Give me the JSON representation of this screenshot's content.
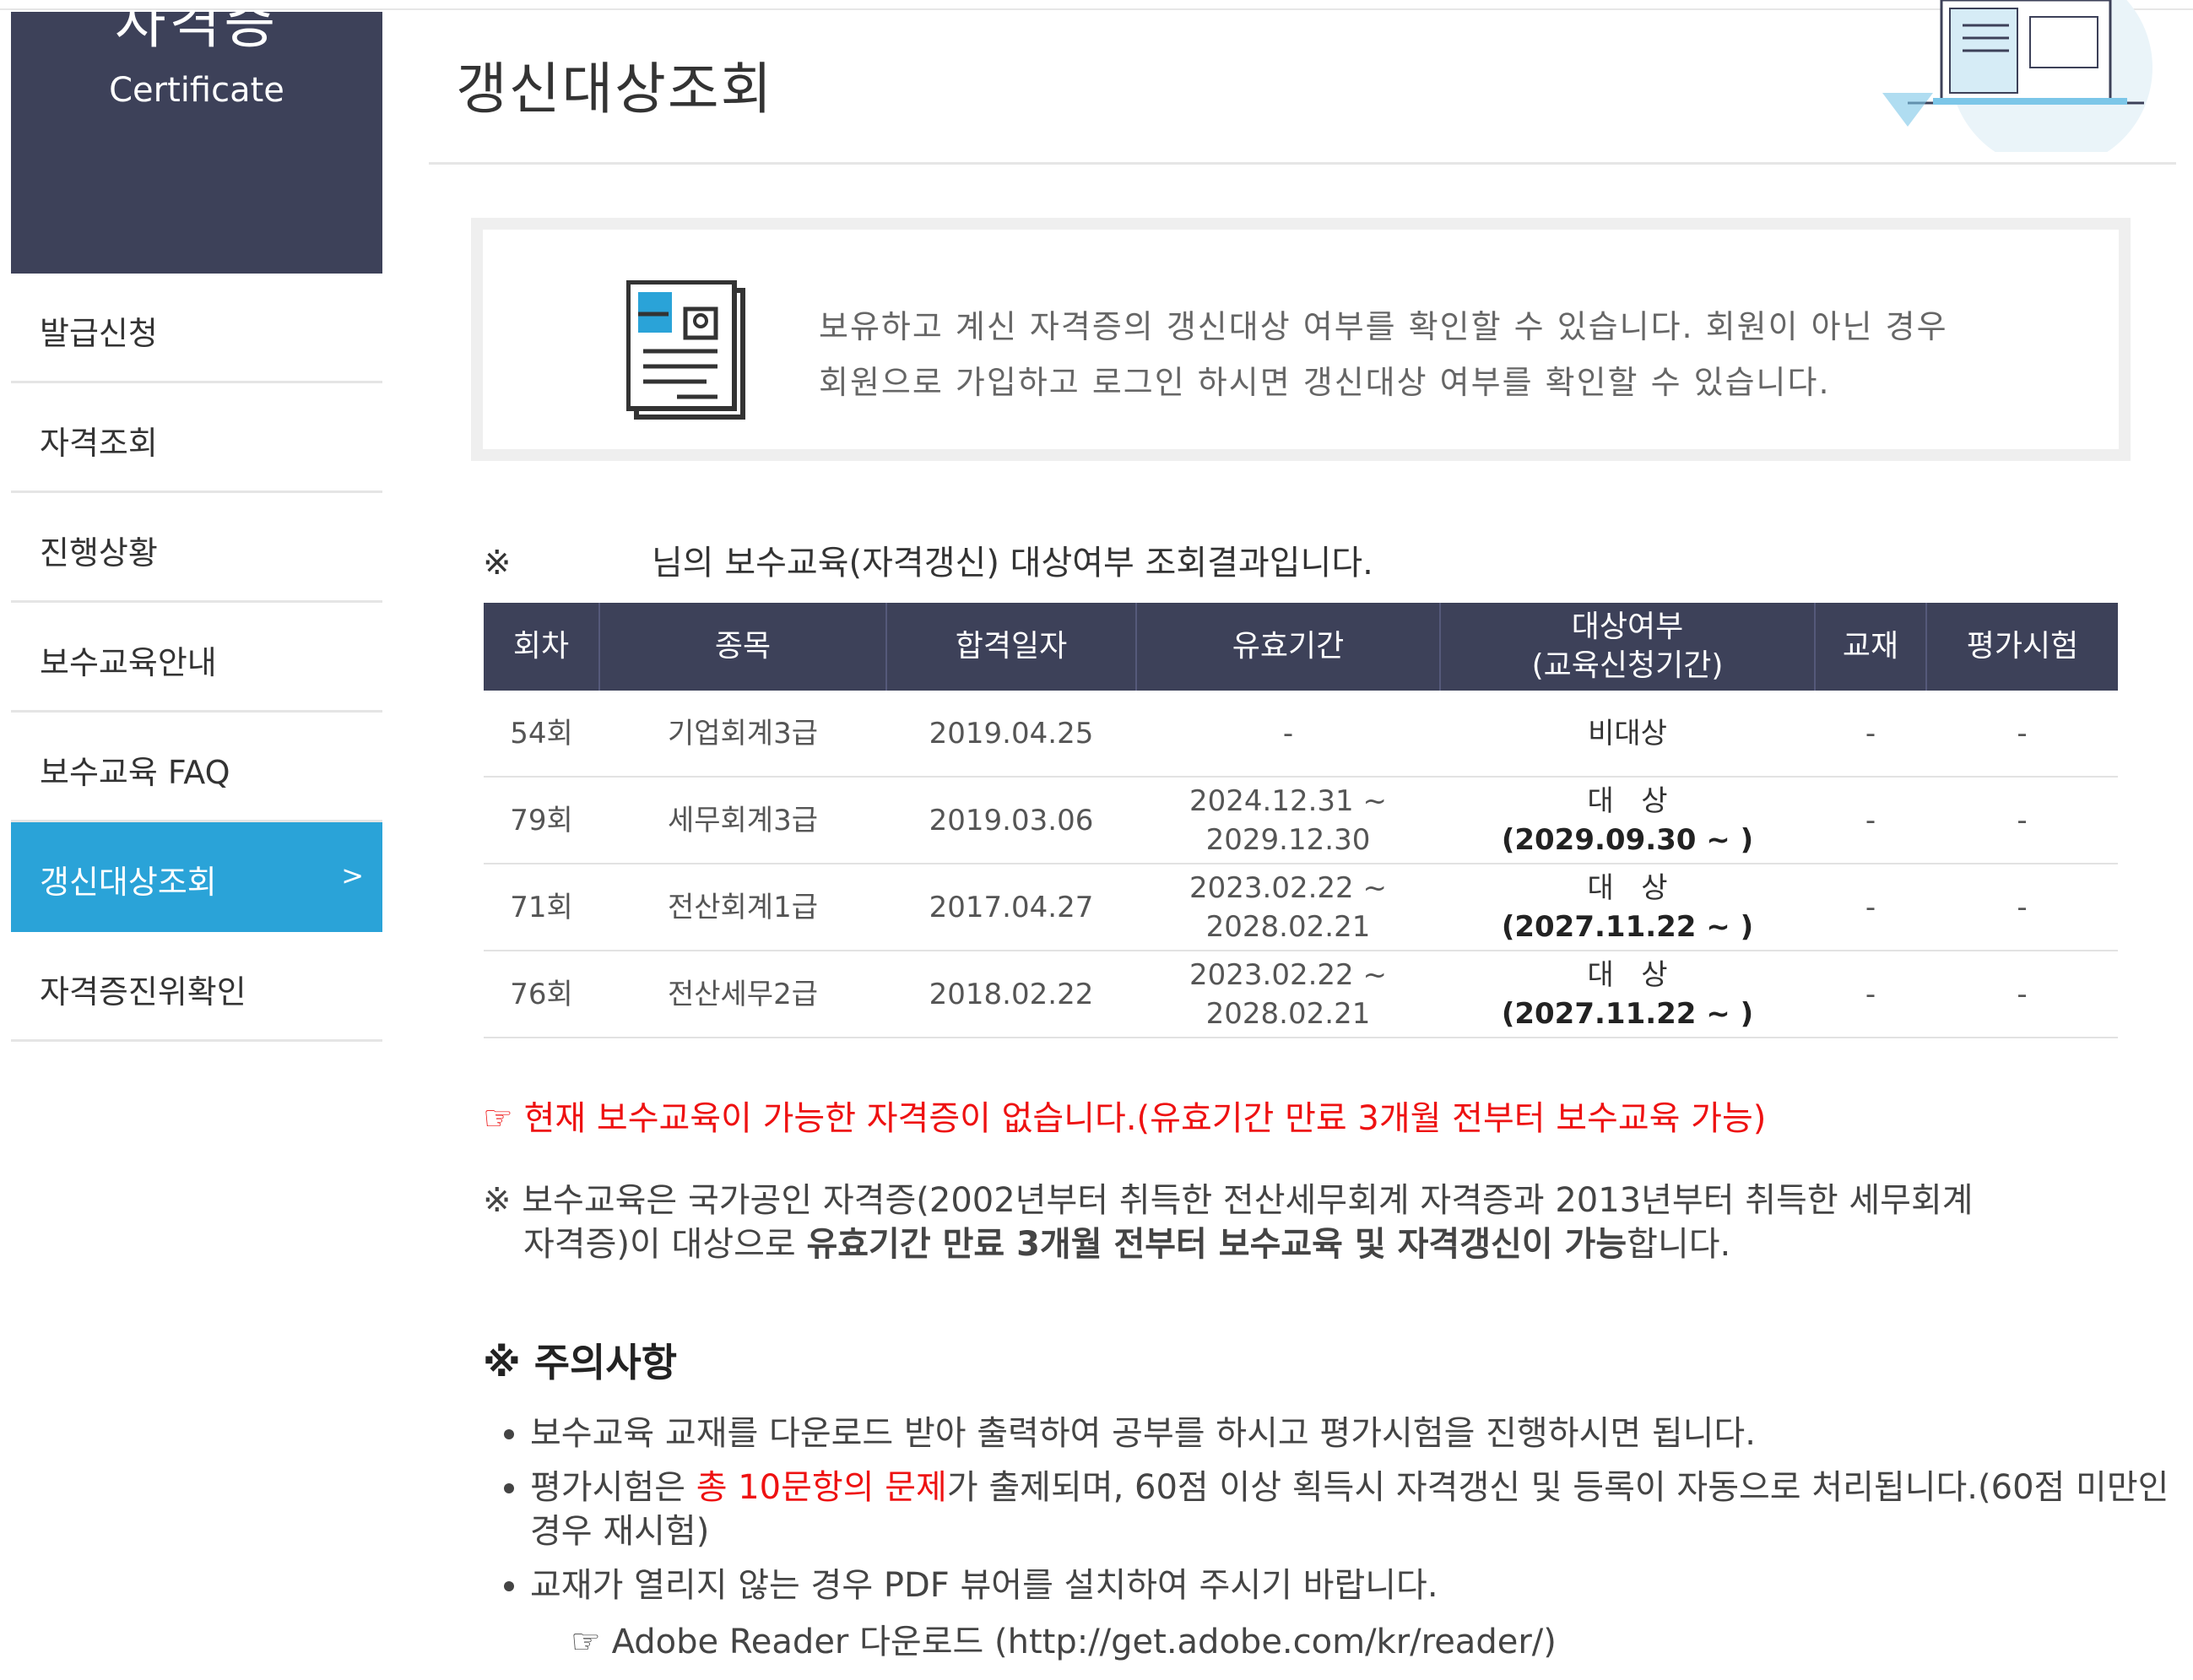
{
  "sidebar": {
    "title_ko": "자격증",
    "title_en": "Certificate",
    "items": [
      {
        "label": "발급신청"
      },
      {
        "label": "자격조회"
      },
      {
        "label": "진행상황"
      },
      {
        "label": "보수교육안내"
      },
      {
        "label": "보수교육 FAQ"
      },
      {
        "label": "갱신대상조회",
        "arrow": ">"
      },
      {
        "label": "자격증진위확인"
      }
    ]
  },
  "page": {
    "title": "갱신대상조회"
  },
  "info": {
    "line1": "보유하고 계신 자격증의 갱신대상 여부를 확인할 수 있습니다. 회원이 아닌 경우",
    "line2": "회원으로 가입하고 로그인 하시면 갱신대상 여부를 확인할 수 있습니다."
  },
  "result": {
    "mark": "※",
    "text": "님의 보수교육(자격갱신) 대상여부 조회결과입니다."
  },
  "table": {
    "headers": {
      "round": "회차",
      "type": "종목",
      "pass_date": "합격일자",
      "valid": "유효기간",
      "target_line1": "대상여부",
      "target_line2": "(교육신청기간)",
      "book": "교재",
      "exam": "평가시험"
    },
    "rows": [
      {
        "round": "54회",
        "type": "기업회계3급",
        "pass_date": "2019.04.25",
        "valid1": "-",
        "valid2": "",
        "target1": "비대상",
        "target2": "",
        "book": "-",
        "exam": "-"
      },
      {
        "round": "79회",
        "type": "세무회계3급",
        "pass_date": "2019.03.06",
        "valid1": "2024.12.31 ~",
        "valid2": "2029.12.30",
        "target1": "대   상",
        "target2": "(2029.09.30 ~ )",
        "book": "-",
        "exam": "-"
      },
      {
        "round": "71회",
        "type": "전산회계1급",
        "pass_date": "2017.04.27",
        "valid1": "2023.02.22 ~",
        "valid2": "2028.02.21",
        "target1": "대   상",
        "target2": "(2027.11.22 ~ )",
        "book": "-",
        "exam": "-"
      },
      {
        "round": "76회",
        "type": "전산세무2급",
        "pass_date": "2018.02.22",
        "valid1": "2023.02.22 ~",
        "valid2": "2028.02.21",
        "target1": "대   상",
        "target2": "(2027.11.22 ~ )",
        "book": "-",
        "exam": "-"
      }
    ]
  },
  "notice": {
    "red": "☞ 현재 보수교육이 가능한 자격증이 없습니다.(유효기간 만료 3개월 전부터 보수교육 가능)",
    "note_a": "※ 보수교육은 국가공인 자격증(2002년부터 취득한 전산세무회계 자격증과 2013년부터 취득한 세무회계",
    "note_b": "자격증)이 대상으로 ",
    "note_bold": "유효기간 만료 3개월 전부터 보수교육 및 자격갱신이 가능",
    "note_c": "합니다."
  },
  "caution": {
    "title": "※ 주의사항",
    "item1": "보수교육 교재를 다운로드 받아 출력하여 공부를 하시고 평가시험을 진행하시면 됩니다.",
    "item2_a": "평가시험은 ",
    "item2_red": "총 10문항의 문제",
    "item2_b": "가 출제되며, 60점 이상 획득시 자격갱신 및 등록이 자동으로 처리됩니다.(60점 미만인 경우 재시험)",
    "item3": "교재가 열리지 않는 경우 PDF 뷰어를 설치하여 주시기 바랍니다.",
    "link": "☞ Adobe Reader 다운로드 (http://get.adobe.com/kr/reader/)"
  },
  "colors": {
    "header_navy": "#3d4159",
    "active_blue": "#2aa3d8",
    "notice_red": "#ee1111"
  },
  "icons": [
    "document-profile-icon",
    "workspace-illustration"
  ]
}
